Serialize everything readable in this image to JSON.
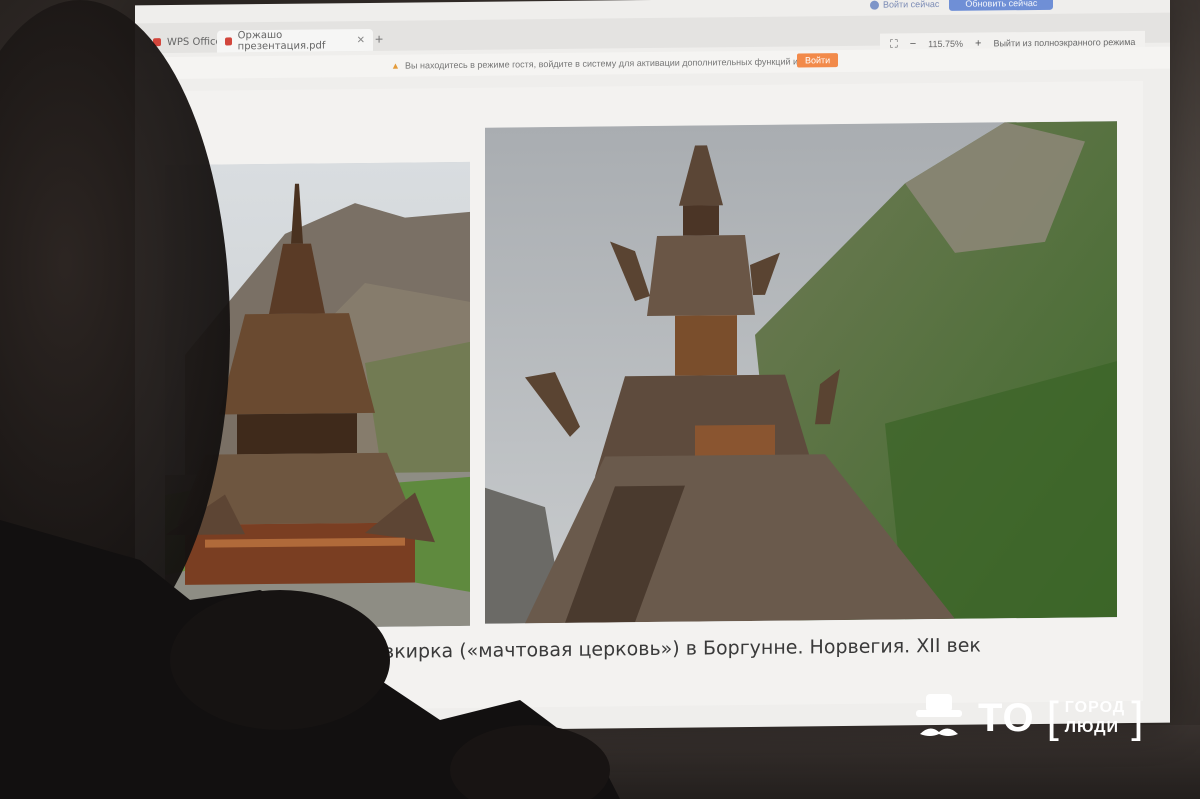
{
  "browser": {
    "app_tab_label": "WPS Office",
    "doc_tab_label": "Оржашо презентация.pdf",
    "new_tab_symbol": "+",
    "login_label": "Войти сейчас",
    "update_button_label": "Обновить сейчас"
  },
  "guest_bar": {
    "message": "Вы находитесь в режиме гостя, войдите в систему для активации дополнительных функций и услуг.",
    "signin_label": "Войти"
  },
  "view_tools": {
    "zoom_out": "−",
    "zoom_level": "115.75%",
    "zoom_in": "+",
    "exit_fullscreen": "Выйти из полноэкранного режима"
  },
  "slide": {
    "caption": "вкирка («мачтовая церковь») в Боргунне. Норвегия. XII век"
  },
  "watermark": {
    "brand_short": "ТО",
    "brand_line1": "ГОРОД",
    "brand_line2": "ЛЮДИ"
  },
  "icons": [
    "red-pdf-icon",
    "close-icon",
    "user-icon",
    "warning-icon",
    "fit-screen-icon",
    "gentleman-logo-icon"
  ],
  "colors": {
    "update_button": "#6f8fd6",
    "signin_button": "#f28a4a",
    "church_wood": "#5a3b26"
  }
}
